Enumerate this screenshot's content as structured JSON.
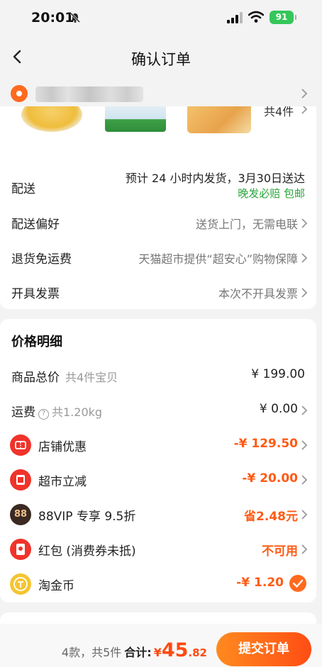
{
  "status_bar": {
    "time": "20:01",
    "battery": "91"
  },
  "nav": {
    "title": "确认订单"
  },
  "items_preview": {
    "count_text": "共4件"
  },
  "delivery": {
    "label": "配送",
    "estimate": "预计 24 小时内发货，3月30日送达",
    "guarantee": "晚发必赔 包邮"
  },
  "preference": {
    "label": "配送偏好",
    "value": "送货上门，无需电联"
  },
  "return_shipping": {
    "label": "退货免运费",
    "value": "天猫超市提供“超安心”购物保障"
  },
  "invoice": {
    "label": "开具发票",
    "value": "本次不开具发票"
  },
  "price_detail": {
    "title": "价格明细",
    "goods_total": {
      "label": "商品总价",
      "sub": "共4件宝贝",
      "value": "¥ 199.00"
    },
    "freight": {
      "label": "运费",
      "help": "?",
      "sub": "共1.20kg",
      "value": "¥ 0.00"
    },
    "shop_discount": {
      "label": "店铺优惠",
      "value": "-¥ 129.50"
    },
    "market_reduce": {
      "label": "超市立减",
      "value": "-¥ 20.00"
    },
    "vip": {
      "icon_text": "88",
      "label": "88VIP 专享 9.5折",
      "value": "省2.48元"
    },
    "red_packet": {
      "label": "红包 (消费券未抵)",
      "value": "不可用"
    },
    "taojinbi": {
      "label": "淘金币",
      "value": "-¥ 1.20"
    }
  },
  "bottom": {
    "summary": "4款，共5件",
    "total_label": "合计:",
    "currency": "¥",
    "amount_int": "45",
    "amount_dec": ".82",
    "submit_label": "提交订单"
  },
  "colors": {
    "accent": "#ff5a14",
    "green": "#2aa63a"
  }
}
